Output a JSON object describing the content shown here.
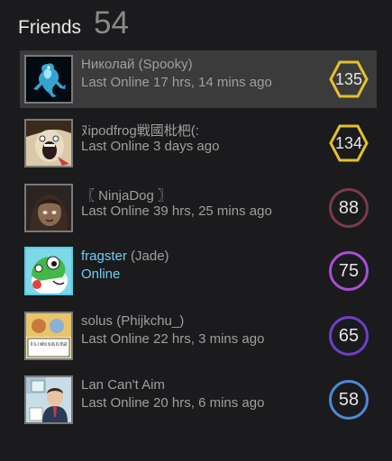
{
  "header": {
    "title": "Friends",
    "count": "54"
  },
  "friends": [
    {
      "persona": "Николай",
      "nick": "(Spooky)",
      "status": "Last Online 17 hrs, 14 mins ago",
      "level": "135",
      "badge_color": "#e2c12b",
      "badge_shape": "hexagon",
      "online": false,
      "avatar_icon": "frog-avatar-icon",
      "selected": true
    },
    {
      "persona": "ﾇipodfrog戦國枇杷(:",
      "nick": "",
      "status": "Last Online 3 days ago",
      "level": "134",
      "badge_color": "#e2c12b",
      "badge_shape": "hexagon",
      "online": false,
      "avatar_icon": "screaming-face-avatar-icon"
    },
    {
      "persona": "〖 NinjaDog 〗",
      "nick": "",
      "status": "Last Online 39 hrs, 25 mins ago",
      "level": "88",
      "badge_color": "#7b3b4a",
      "badge_shape": "circle",
      "online": false,
      "avatar_icon": "anime-girl-avatar-icon"
    },
    {
      "persona": "fragster",
      "nick": "(Jade)",
      "status": "Online",
      "level": "75",
      "badge_color": "#a84fd6",
      "badge_shape": "circle",
      "online": true,
      "avatar_icon": "yoshi-cartoon-avatar-icon"
    },
    {
      "persona": "solus",
      "nick": "(Phijkchu_)",
      "status": "Last Online 22 hrs, 3 mins ago",
      "level": "65",
      "badge_color": "#6e3ec9",
      "badge_shape": "circle",
      "online": false,
      "avatar_icon": "comic-avatar-icon"
    },
    {
      "persona": "Lan Can't Aim",
      "nick": "",
      "status": "Last Online 20 hrs, 6 mins ago",
      "level": "58",
      "badge_color": "#4d8ad8",
      "badge_shape": "circle",
      "online": false,
      "avatar_icon": "office-man-avatar-icon"
    }
  ],
  "avatar_texts": {
    "comic_caption": "It is I who nuts to that"
  }
}
